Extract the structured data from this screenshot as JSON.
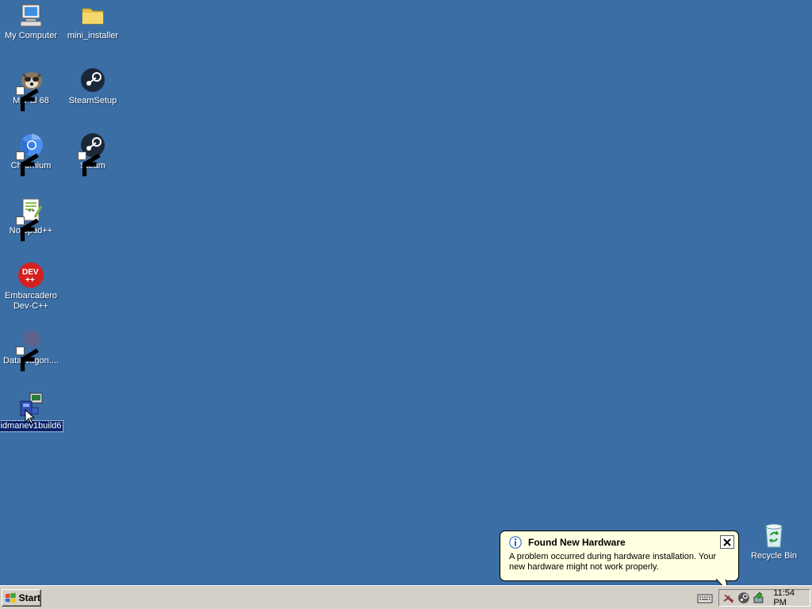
{
  "desktop": {
    "icons": [
      {
        "label": "My Computer"
      },
      {
        "label": "mini_installer"
      },
      {
        "label": "MyPal 68"
      },
      {
        "label": "SteamSetup"
      },
      {
        "label": "Chromium"
      },
      {
        "label": "Steam"
      },
      {
        "label": "Notepad++"
      },
      {
        "label": "Embarcadero\nDev-C++"
      },
      {
        "label": "DataWagon...."
      },
      {
        "label": "idmanev1build6"
      },
      {
        "label": "Recycle Bin"
      }
    ],
    "background_color": "#3a6ea5"
  },
  "balloon": {
    "title": "Found New Hardware",
    "message": "A problem occurred during hardware installation. Your new hardware might not work properly.",
    "icon": "info-icon"
  },
  "taskbar": {
    "start_label": "Start",
    "clock": "11:54 PM"
  }
}
